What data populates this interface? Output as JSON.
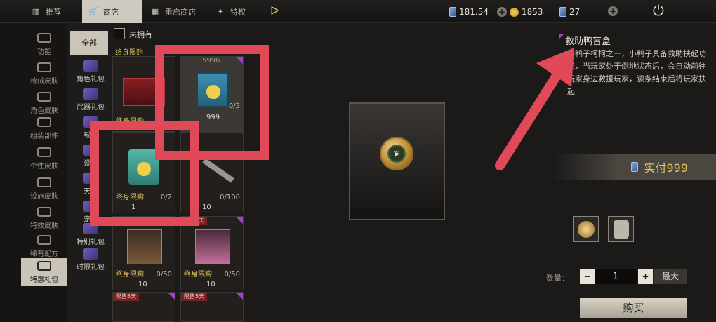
{
  "topbar": {
    "tabs": [
      {
        "label": "推荐",
        "icon": "store-icon"
      },
      {
        "label": "商店",
        "icon": "cart-icon"
      },
      {
        "label": "重启商店",
        "icon": "restart-store-icon"
      },
      {
        "label": "特权",
        "icon": "privilege-icon"
      }
    ],
    "currency_a": "181.54",
    "currency_b": "1853",
    "currency_c": "27"
  },
  "leftnav": [
    {
      "label": "功能"
    },
    {
      "label": "枪械皮肤"
    },
    {
      "label": "角色皮肤"
    },
    {
      "label": "组装部件"
    },
    {
      "label": "个性皮肤"
    },
    {
      "label": "设施皮肤"
    },
    {
      "label": "特效皮肤"
    },
    {
      "label": "稀有配方"
    },
    {
      "label": "特惠礼包"
    }
  ],
  "subnav": {
    "all": "全部",
    "items": [
      "角色礼包",
      "武器礼包",
      "载具",
      "设施",
      "天赋",
      "宠物",
      "特别礼包",
      "时限礼包"
    ]
  },
  "filter": {
    "label": "未拥有"
  },
  "items": [
    {
      "title": "终身限购",
      "price": "5996",
      "count": "0/3",
      "qty": "999"
    },
    {
      "title": "终身限购",
      "price": "1",
      "count": "0/2"
    },
    {
      "title": "",
      "price": "10",
      "count": "0/100",
      "tag": "限售5天"
    },
    {
      "title": "终身限购",
      "price": "10",
      "count": "0/50",
      "tag": "限售5天"
    },
    {
      "title": "终身限购",
      "price": "10",
      "count": "0/50",
      "tag": "限售5天"
    },
    {
      "title": "",
      "price": "",
      "count": "",
      "tag": "限售5天"
    },
    {
      "title": "",
      "price": "",
      "count": "",
      "tag": "限售5天"
    }
  ],
  "detail": {
    "title": "救助鸭盲盒",
    "description": "小鸭子柯柯之一，小鸭子具备救助扶起功能，当玩家处于倒地状态后，会自动前往玩家身边救援玩家，读条结束后将玩家扶起",
    "pay_label": "实付999",
    "qty_label": "数量：",
    "qty_value": "1",
    "minus": "−",
    "plus": "+",
    "max_label": "最大",
    "buy_label": "购买"
  },
  "colors": {
    "accent": "#e3c55a",
    "highlight": "#e04a58",
    "rarity": "#a043c9"
  }
}
